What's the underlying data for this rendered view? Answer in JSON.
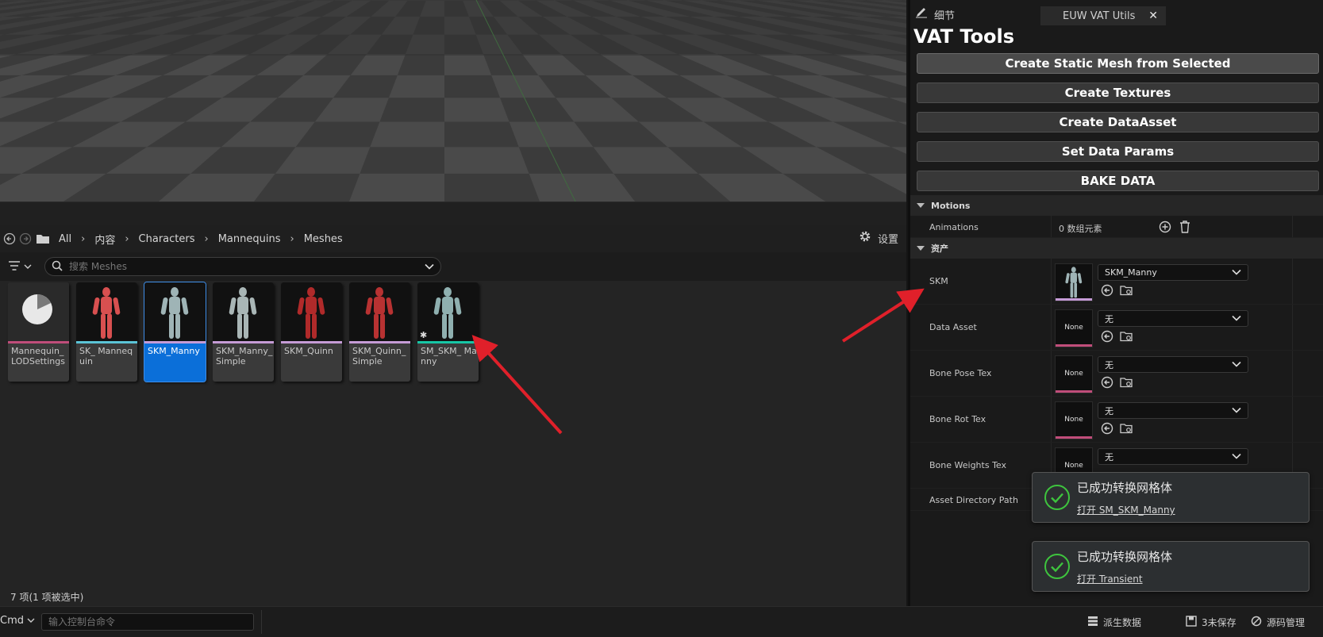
{
  "breadcrumb": {
    "items": [
      "All",
      "内容",
      "Characters",
      "Mannequins",
      "Meshes"
    ],
    "settings_label": "设置"
  },
  "filter": {
    "search_placeholder": "搜索 Meshes"
  },
  "tiles": [
    {
      "label": "Mannequin_ LODSettings",
      "stripe": "#c04d7a"
    },
    {
      "label": "SK_ Mannequin",
      "stripe": "#5bc4d6"
    },
    {
      "label": "SKM_Manny",
      "stripe": "#c59bd6",
      "selected": true
    },
    {
      "label": "SKM_Manny_ Simple",
      "stripe": "#c59bd6"
    },
    {
      "label": "SKM_Quinn",
      "stripe": "#c59bd6"
    },
    {
      "label": "SKM_Quinn_ Simple",
      "stripe": "#c59bd6"
    },
    {
      "label": "SM_SKM_ Manny",
      "stripe": "#17c6a6"
    }
  ],
  "content_browser": {
    "item_count": "7 项(1 项被选中)"
  },
  "statusbar": {
    "cmd_label": "Cmd",
    "cmd_placeholder": "输入控制台命令",
    "derived_data": "派生数据",
    "unsaved": "3未保存",
    "source_control": "源码管理"
  },
  "details": {
    "tab_details": "细节",
    "tab_euw": "EUW VAT Utils",
    "title": "VAT Tools",
    "buttons": [
      "Create Static Mesh from Selected",
      "Create Textures",
      "Create DataAsset",
      "Set Data Params",
      "BAKE DATA"
    ],
    "motions_header": "Motions",
    "animations_label": "Animations",
    "animations_value": "0 数组元素",
    "assets_header": "资产",
    "props": [
      {
        "name": "SKM",
        "value": "SKM_Manny",
        "thumb": ""
      },
      {
        "name": "Data Asset",
        "value": "无",
        "thumb": "None"
      },
      {
        "name": "Bone Pose Tex",
        "value": "无",
        "thumb": "None"
      },
      {
        "name": "Bone Rot Tex",
        "value": "无",
        "thumb": "None"
      },
      {
        "name": "Bone Weights Tex",
        "value": "无",
        "thumb": "None"
      }
    ],
    "asset_dir_label": "Asset Directory Path"
  },
  "toasts": [
    {
      "message": "已成功转换网格体",
      "link": "打开 SM_SKM_Manny"
    },
    {
      "message": "已成功转换网格体",
      "link": "打开 Transient"
    }
  ],
  "colors": {
    "accent_selected": "#0b6fd9",
    "success_green": "#3ec43e",
    "annotation_red": "#e0202a"
  }
}
